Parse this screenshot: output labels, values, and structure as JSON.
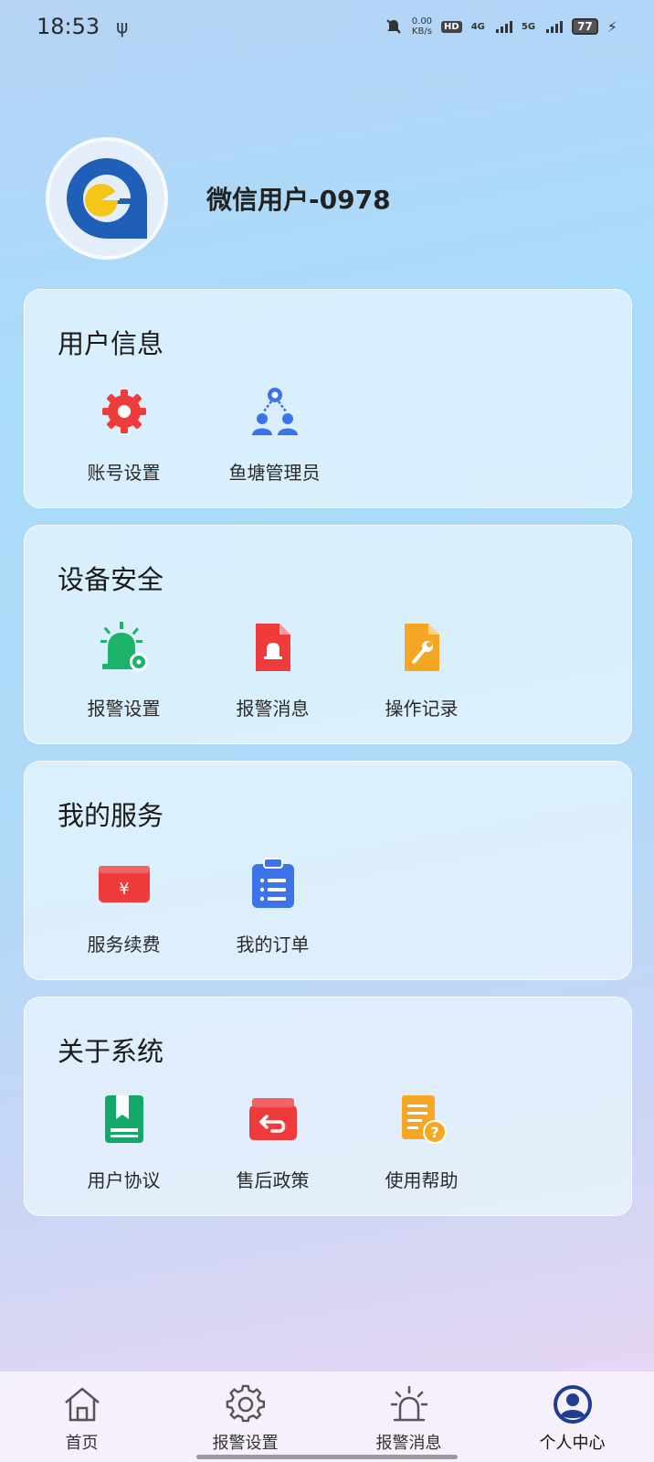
{
  "status_bar": {
    "time": "18:53",
    "net_speed_value": "0.00",
    "net_speed_unit": "KB/s",
    "hd_label": "HD",
    "net_4g": "4G",
    "net_5g": "5G",
    "battery": "77"
  },
  "profile": {
    "username": "微信用户-0978"
  },
  "sections": {
    "user_info": {
      "title": "用户信息",
      "items": [
        {
          "label": "账号设置",
          "icon": "gear-icon",
          "color": "#ef3b3b"
        },
        {
          "label": "鱼塘管理员",
          "icon": "admin-group-icon",
          "color": "#3d73e8"
        }
      ]
    },
    "device_security": {
      "title": "设备安全",
      "items": [
        {
          "label": "报警设置",
          "icon": "alarm-settings-icon",
          "color": "#1db36b"
        },
        {
          "label": "报警消息",
          "icon": "alarm-message-icon",
          "color": "#ef3b3b"
        },
        {
          "label": "操作记录",
          "icon": "operation-log-icon",
          "color": "#f5a623"
        }
      ]
    },
    "my_services": {
      "title": "我的服务",
      "items": [
        {
          "label": "服务续费",
          "icon": "renewal-icon",
          "color": "#ef3b3b"
        },
        {
          "label": "我的订单",
          "icon": "orders-icon",
          "color": "#3d73e8"
        }
      ]
    },
    "about_system": {
      "title": "关于系统",
      "items": [
        {
          "label": "用户协议",
          "icon": "agreement-icon",
          "color": "#13a86a"
        },
        {
          "label": "售后政策",
          "icon": "after-sales-icon",
          "color": "#ef3b3b"
        },
        {
          "label": "使用帮助",
          "icon": "help-icon",
          "color": "#f5a623"
        }
      ]
    }
  },
  "tabs": [
    {
      "label": "首页",
      "icon": "home-icon"
    },
    {
      "label": "报警设置",
      "icon": "gear-icon"
    },
    {
      "label": "报警消息",
      "icon": "alarm-icon"
    },
    {
      "label": "个人中心",
      "icon": "profile-icon",
      "active": true
    }
  ],
  "colors": {
    "accent_blue": "#1e3f8f",
    "red": "#ef3b3b",
    "green": "#1db36b",
    "orange": "#f5a623",
    "blue": "#3d73e8"
  }
}
